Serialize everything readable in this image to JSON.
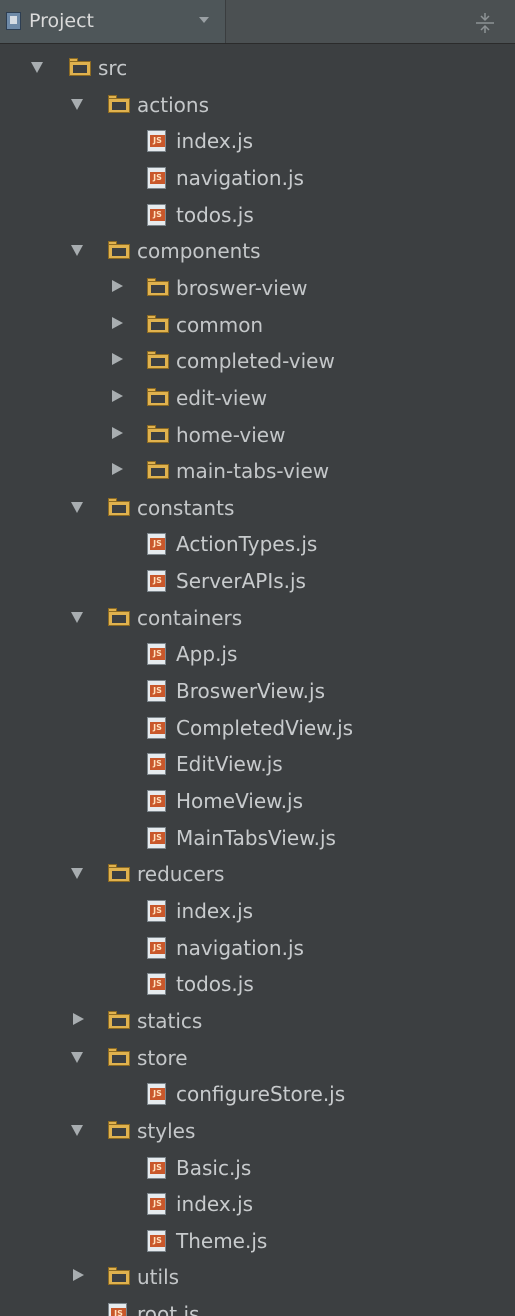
{
  "header": {
    "title": "Project",
    "icon": "project-icon",
    "dropdown_icon": "chevron-down-icon",
    "collapse_icon": "collapse-all-icon"
  },
  "tree": [
    {
      "label": "src",
      "type": "folder",
      "expanded": true,
      "depth": 0
    },
    {
      "label": "actions",
      "type": "folder",
      "expanded": true,
      "depth": 1
    },
    {
      "label": "index.js",
      "type": "file",
      "depth": 2
    },
    {
      "label": "navigation.js",
      "type": "file",
      "depth": 2
    },
    {
      "label": "todos.js",
      "type": "file",
      "depth": 2
    },
    {
      "label": "components",
      "type": "folder",
      "expanded": true,
      "depth": 1
    },
    {
      "label": "broswer-view",
      "type": "folder",
      "expanded": false,
      "depth": 2
    },
    {
      "label": "common",
      "type": "folder",
      "expanded": false,
      "depth": 2
    },
    {
      "label": "completed-view",
      "type": "folder",
      "expanded": false,
      "depth": 2
    },
    {
      "label": "edit-view",
      "type": "folder",
      "expanded": false,
      "depth": 2
    },
    {
      "label": "home-view",
      "type": "folder",
      "expanded": false,
      "depth": 2
    },
    {
      "label": "main-tabs-view",
      "type": "folder",
      "expanded": false,
      "depth": 2
    },
    {
      "label": "constants",
      "type": "folder",
      "expanded": true,
      "depth": 1
    },
    {
      "label": "ActionTypes.js",
      "type": "file",
      "depth": 2
    },
    {
      "label": "ServerAPIs.js",
      "type": "file",
      "depth": 2
    },
    {
      "label": "containers",
      "type": "folder",
      "expanded": true,
      "depth": 1
    },
    {
      "label": "App.js",
      "type": "file",
      "depth": 2
    },
    {
      "label": "BroswerView.js",
      "type": "file",
      "depth": 2
    },
    {
      "label": "CompletedView.js",
      "type": "file",
      "depth": 2
    },
    {
      "label": "EditView.js",
      "type": "file",
      "depth": 2
    },
    {
      "label": "HomeView.js",
      "type": "file",
      "depth": 2
    },
    {
      "label": "MainTabsView.js",
      "type": "file",
      "depth": 2
    },
    {
      "label": "reducers",
      "type": "folder",
      "expanded": true,
      "depth": 1
    },
    {
      "label": "index.js",
      "type": "file",
      "depth": 2
    },
    {
      "label": "navigation.js",
      "type": "file",
      "depth": 2
    },
    {
      "label": "todos.js",
      "type": "file",
      "depth": 2
    },
    {
      "label": "statics",
      "type": "folder",
      "expanded": false,
      "depth": 1
    },
    {
      "label": "store",
      "type": "folder",
      "expanded": true,
      "depth": 1
    },
    {
      "label": "configureStore.js",
      "type": "file",
      "depth": 2
    },
    {
      "label": "styles",
      "type": "folder",
      "expanded": true,
      "depth": 1
    },
    {
      "label": "Basic.js",
      "type": "file",
      "depth": 2
    },
    {
      "label": "index.js",
      "type": "file",
      "depth": 2
    },
    {
      "label": "Theme.js",
      "type": "file",
      "depth": 2
    },
    {
      "label": "utils",
      "type": "folder",
      "expanded": false,
      "depth": 1
    },
    {
      "label": "root.js",
      "type": "file",
      "depth": 1
    }
  ],
  "file_badge": "JS",
  "colors": {
    "background": "#3c3f41",
    "folder": "#e0b24e",
    "js_badge": "#c9582b",
    "text": "#c4c7c9"
  }
}
